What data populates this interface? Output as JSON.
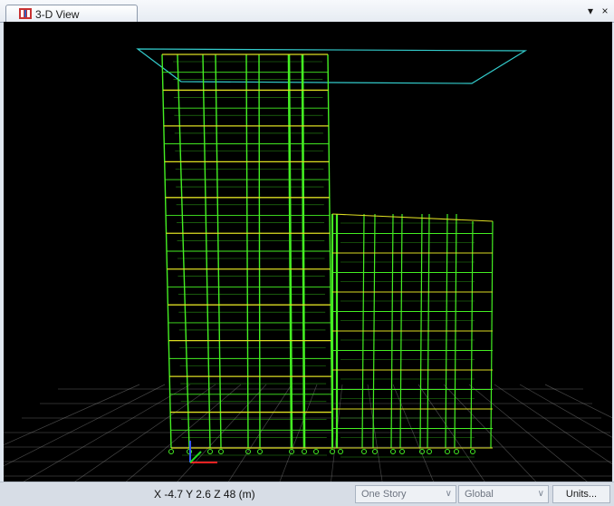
{
  "tab": {
    "title": "3-D View",
    "icon": "3d-view-icon"
  },
  "window_controls": {
    "dropdown": "▾",
    "close": "×"
  },
  "status": {
    "coords": "X -4.7  Y 2.6  Z 48 (m)",
    "story_select": "One Story",
    "coord_system": "Global",
    "units_button": "Units..."
  },
  "colors": {
    "frame": "#44ee22",
    "beam": "#dddd22",
    "slab": "#33cccc",
    "grid": "#9a9a9a",
    "background": "#000000"
  }
}
